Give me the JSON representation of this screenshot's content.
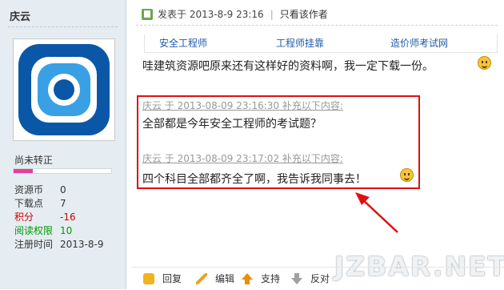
{
  "sidebar": {
    "username": "庆云",
    "rank": "尚未转正",
    "rank_progress": 0.2,
    "stats": [
      {
        "key": "资源币",
        "value": "0"
      },
      {
        "key": "下载点",
        "value": "7"
      },
      {
        "key": "积分",
        "value": "-16"
      },
      {
        "key": "阅读权限",
        "value": "10"
      },
      {
        "key": "注册时间",
        "value": "2013-8-9"
      }
    ]
  },
  "post": {
    "posted_at": "发表于 2013-8-9 23:16",
    "only_author": "只看该作者",
    "ad_links": [
      "安全工程师",
      "工程师挂靠",
      "造价师考试网"
    ],
    "content": "哇建筑资源吧原来还有这样好的资料啊，我一定下载一份。",
    "supplements": [
      {
        "meta": "庆云 于 2013-08-09 23:16:30 补充以下内容:",
        "text": "全部都是今年安全工程师的考试题？"
      },
      {
        "meta": "庆云 于 2013-08-09 23:17:02 补充以下内容:",
        "text": "四个科目全部都齐全了啊，我告诉我同事去！"
      }
    ]
  },
  "actions": {
    "reply": "回复",
    "edit": "编辑",
    "support": "支持",
    "oppose": "反对"
  },
  "watermark": "JZBAR.NET",
  "colors": {
    "sidebar_bg": "#e5edf2",
    "highlight": "#e01010",
    "link": "#1f5ba8",
    "negative": "#cc0000",
    "positive": "#009900",
    "rank_bar": "#e040a0"
  },
  "icons": [
    "online-icon",
    "smiley-icon",
    "reply-icon",
    "edit-icon",
    "support-arrow-icon",
    "oppose-arrow-icon"
  ]
}
